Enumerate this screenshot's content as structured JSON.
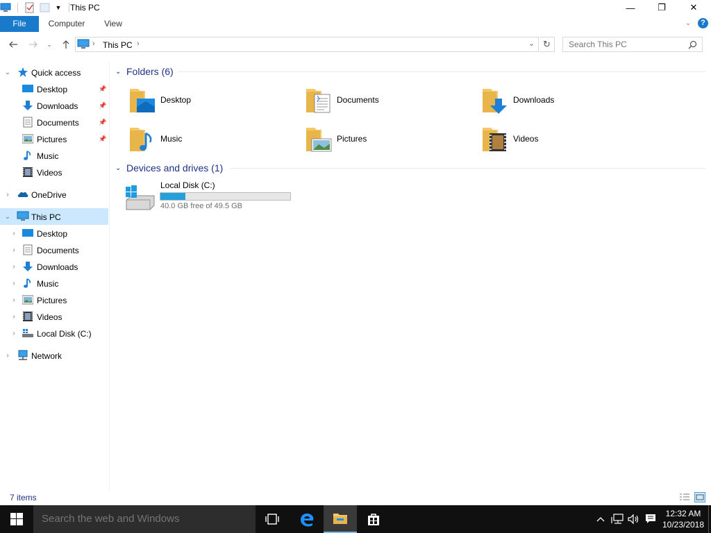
{
  "window": {
    "title": "This PC",
    "controls": {
      "minimize": "—",
      "maximize": "❐",
      "close": "✕"
    }
  },
  "ribbon": {
    "tabs": [
      {
        "label": "File"
      },
      {
        "label": "Computer"
      },
      {
        "label": "View"
      }
    ],
    "help": "?"
  },
  "navbar": {
    "breadcrumb": [
      "This PC"
    ],
    "search_placeholder": "Search This PC"
  },
  "navpane": {
    "quick_access": {
      "label": "Quick access",
      "items": [
        {
          "label": "Desktop",
          "icon": "desktop-icon",
          "pinned": true
        },
        {
          "label": "Downloads",
          "icon": "downloads-icon",
          "pinned": true
        },
        {
          "label": "Documents",
          "icon": "documents-icon",
          "pinned": true
        },
        {
          "label": "Pictures",
          "icon": "pictures-icon",
          "pinned": true
        },
        {
          "label": "Music",
          "icon": "music-icon",
          "pinned": false
        },
        {
          "label": "Videos",
          "icon": "videos-icon",
          "pinned": false
        }
      ]
    },
    "onedrive": {
      "label": "OneDrive"
    },
    "this_pc": {
      "label": "This PC",
      "items": [
        {
          "label": "Desktop"
        },
        {
          "label": "Documents"
        },
        {
          "label": "Downloads"
        },
        {
          "label": "Music"
        },
        {
          "label": "Pictures"
        },
        {
          "label": "Videos"
        },
        {
          "label": "Local Disk (C:)"
        }
      ]
    },
    "network": {
      "label": "Network"
    }
  },
  "content": {
    "folders_header": "Folders (6)",
    "folders": [
      {
        "label": "Desktop"
      },
      {
        "label": "Documents"
      },
      {
        "label": "Downloads"
      },
      {
        "label": "Music"
      },
      {
        "label": "Pictures"
      },
      {
        "label": "Videos"
      }
    ],
    "devices_header": "Devices and drives (1)",
    "drive": {
      "label": "Local Disk (C:)",
      "free_text": "40.0 GB free of 49.5 GB",
      "used_fraction": 0.19
    }
  },
  "status": {
    "items": "7 items"
  },
  "taskbar": {
    "search_placeholder": "Search the web and Windows",
    "time": "12:32 AM",
    "date": "10/23/2018"
  },
  "colors": {
    "accent": "#1979ca",
    "selection": "#cce8ff",
    "group_header": "#1e3287",
    "drive_bar": "#26a0da",
    "folder": "#f5c96a"
  }
}
